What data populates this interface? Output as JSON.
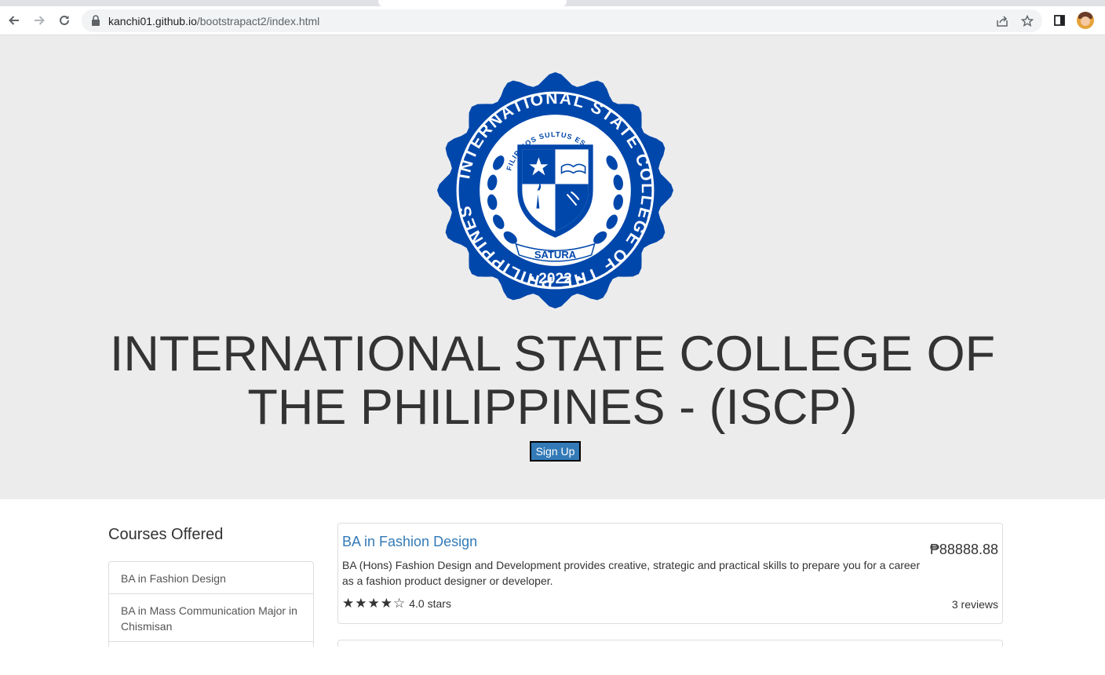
{
  "browser": {
    "url_host": "kanchi01.github.io",
    "url_path": "/bootstrapact2/index.html"
  },
  "seal": {
    "ring_text": "INTERNATIONAL STATE COLLEGE OF THE PHILIPPINES",
    "motto": "FILIPINOS SULTUS ES",
    "banner": "SATURA",
    "year": "2022",
    "color": "#0047ab"
  },
  "hero": {
    "title_line1": "INTERNATIONAL STATE COLLEGE OF",
    "title_line2": "THE PHILIPPINES - (ISCP)",
    "signup_label": "Sign Up"
  },
  "sidebar": {
    "heading": "Courses Offered",
    "items": [
      {
        "label": "BA in Fashion Design"
      },
      {
        "label": "BA in Mass Communication Major in Chismisan"
      }
    ]
  },
  "course_card": {
    "title": "BA in Fashion Design",
    "price": "₱88888.88",
    "description": "BA (Hons) Fashion Design and Development provides creative, strategic and practical skills to prepare you for a career as a fashion product designer or developer.",
    "rating": 4,
    "rating_max": 5,
    "rating_text": "4.0 stars",
    "reviews": "3 reviews"
  },
  "colors": {
    "hero_bg": "#ececec",
    "link": "#337ab7",
    "button": "#337ab7"
  }
}
